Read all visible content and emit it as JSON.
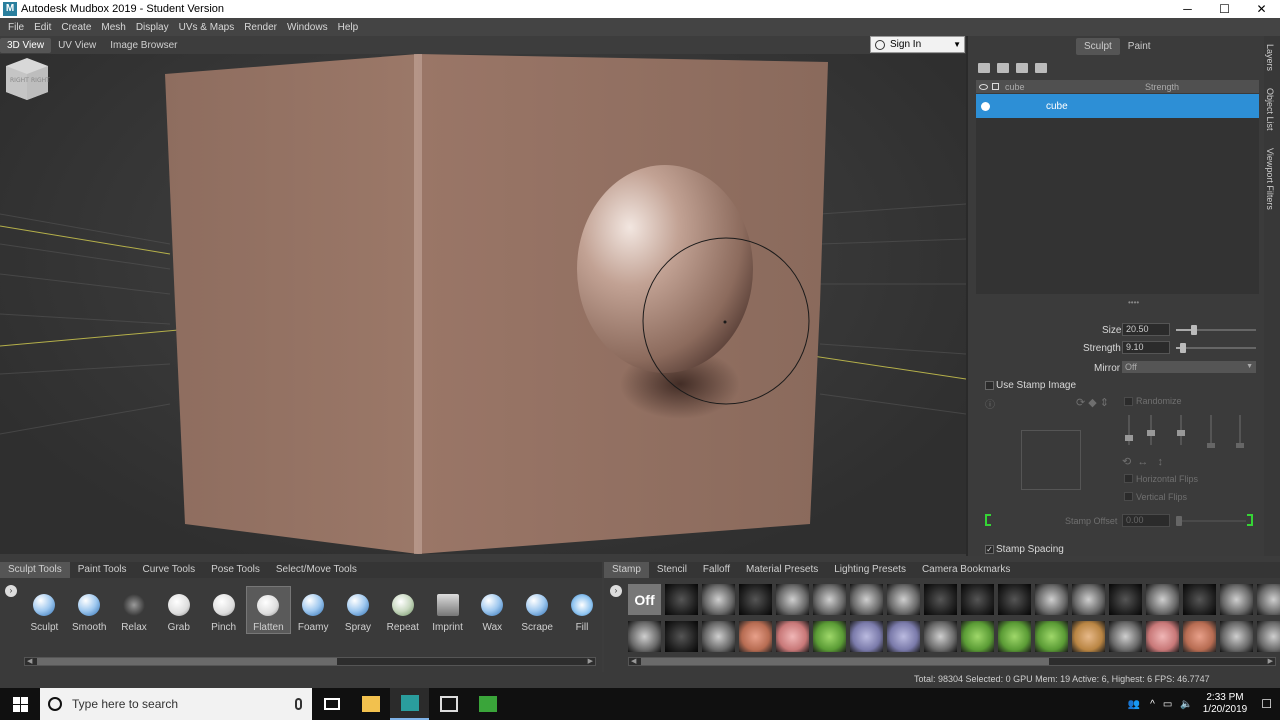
{
  "window": {
    "title": "Autodesk Mudbox 2019 - Student Version",
    "app_icon": "M",
    "minimize": "─",
    "maximize": "☐",
    "close": "✕"
  },
  "menu": [
    "File",
    "Edit",
    "Create",
    "Mesh",
    "Display",
    "UVs & Maps",
    "Render",
    "Windows",
    "Help"
  ],
  "view_tabs": [
    "3D View",
    "UV View",
    "Image Browser"
  ],
  "signin": {
    "label": "Sign In"
  },
  "viewcube": {
    "left": "RIGHT",
    "right": "RIGHT"
  },
  "mode_tabs": [
    "Sculpt",
    "Paint"
  ],
  "layers": {
    "header_name": "cube",
    "header_strength": "Strength",
    "row_name": "cube"
  },
  "properties": {
    "size_label": "Size",
    "size_value": "20.50",
    "size_fraction": 0.22,
    "strength_label": "Strength",
    "strength_value": "9.10",
    "strength_fraction": 0.09,
    "mirror_label": "Mirror",
    "mirror_value": "Off",
    "use_stamp_label": "Use Stamp Image",
    "randomize_label": "Randomize",
    "horizontal_flips_label": "Horizontal Flips",
    "vertical_flips_label": "Vertical Flips",
    "stamp_offset_label": "Stamp Offset",
    "stamp_offset_value": "0.00",
    "stamp_spacing_label": "Stamp Spacing",
    "stamp_spacing_check": "✓"
  },
  "side_tabs": [
    "Layers",
    "Object List",
    "Viewport Filters"
  ],
  "tool_tabs": [
    "Sculpt Tools",
    "Paint Tools",
    "Curve Tools",
    "Pose Tools",
    "Select/Move Tools"
  ],
  "tools": [
    "Sculpt",
    "Smooth",
    "Relax",
    "Grab",
    "Pinch",
    "Flatten",
    "Foamy",
    "Spray",
    "Repeat",
    "Imprint",
    "Wax",
    "Scrape",
    "Fill"
  ],
  "stamp_tabs": [
    "Stamp",
    "Stencil",
    "Falloff",
    "Material Presets",
    "Lighting Presets",
    "Camera Bookmarks"
  ],
  "stamp_off_label": "Off",
  "status": {
    "text": "Total: 98304  Selected: 0 GPU Mem: 19  Active: 6, Highest: 6  FPS: 46.7747"
  },
  "taskbar": {
    "search_placeholder": "Type here to search",
    "time": "2:33 PM",
    "date": "1/20/2019"
  },
  "tray_arrow": "›"
}
